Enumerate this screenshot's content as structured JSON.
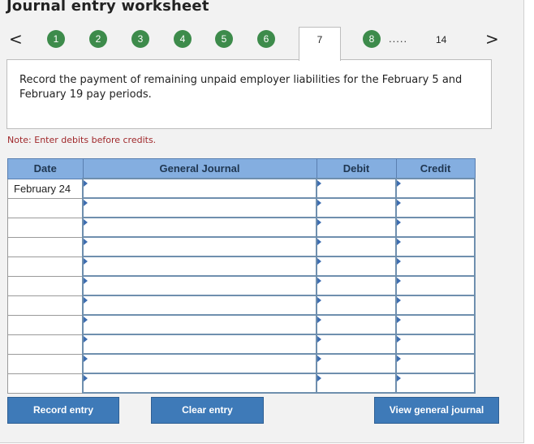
{
  "page": {
    "title": "Journal entry worksheet",
    "nav": {
      "prev_symbol": "<",
      "next_symbol": ">",
      "steps": [
        "1",
        "2",
        "3",
        "4",
        "5",
        "6"
      ],
      "active_step": "7",
      "after_active": [
        "8"
      ],
      "ellipsis": ".....",
      "last_step": "14"
    },
    "instruction": "Record the payment of remaining unpaid employer liabilities for the February 5 and February 19 pay periods.",
    "note": "Note: Enter debits before credits.",
    "table": {
      "headers": {
        "date": "Date",
        "general_journal": "General Journal",
        "debit": "Debit",
        "credit": "Credit"
      },
      "rows": [
        {
          "date": "February 24",
          "account": "",
          "debit": "",
          "credit": ""
        },
        {
          "date": "",
          "account": "",
          "debit": "",
          "credit": ""
        },
        {
          "date": "",
          "account": "",
          "debit": "",
          "credit": ""
        },
        {
          "date": "",
          "account": "",
          "debit": "",
          "credit": ""
        },
        {
          "date": "",
          "account": "",
          "debit": "",
          "credit": ""
        },
        {
          "date": "",
          "account": "",
          "debit": "",
          "credit": ""
        },
        {
          "date": "",
          "account": "",
          "debit": "",
          "credit": ""
        },
        {
          "date": "",
          "account": "",
          "debit": "",
          "credit": ""
        },
        {
          "date": "",
          "account": "",
          "debit": "",
          "credit": ""
        },
        {
          "date": "",
          "account": "",
          "debit": "",
          "credit": ""
        },
        {
          "date": "",
          "account": "",
          "debit": "",
          "credit": ""
        }
      ]
    },
    "buttons": {
      "record": "Record entry",
      "clear": "Clear entry",
      "view": "View general journal"
    },
    "colors": {
      "step_green": "#3d8b4b",
      "header_blue": "#84aee0",
      "button_blue": "#3e7ab8",
      "note_red": "#a0282b"
    }
  }
}
